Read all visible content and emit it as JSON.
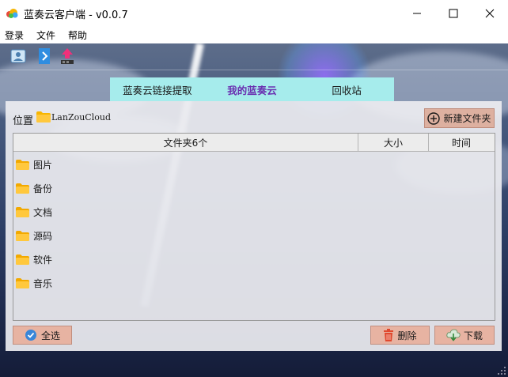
{
  "window": {
    "title": "蓝奏云客户端 - v0.0.7",
    "icon": "cloud-app-icon"
  },
  "menu": [
    "登录",
    "文件",
    "帮助"
  ],
  "toolbar": {
    "items": [
      "login-icon",
      "upload-icon",
      "transfer-icon"
    ]
  },
  "tabs": [
    {
      "label": "蓝奏云链接提取",
      "active": false
    },
    {
      "label": "我的蓝奏云",
      "active": true
    },
    {
      "label": "回收站",
      "active": false
    }
  ],
  "location": {
    "label": "位置",
    "path": "LanZouCloud"
  },
  "new_folder_label": "新建文件夹",
  "table": {
    "headers": [
      "文件夹6个",
      "大小",
      "时间"
    ],
    "rows": [
      {
        "name": "图片",
        "size": "",
        "time": ""
      },
      {
        "name": "备份",
        "size": "",
        "time": ""
      },
      {
        "name": "文档",
        "size": "",
        "time": ""
      },
      {
        "name": "源码",
        "size": "",
        "time": ""
      },
      {
        "name": "软件",
        "size": "",
        "time": ""
      },
      {
        "name": "音乐",
        "size": "",
        "time": ""
      }
    ]
  },
  "actions": {
    "select_all": "全选",
    "delete": "删除",
    "download": "下载"
  },
  "colors": {
    "tab_bar": "#a6ecec",
    "active_tab_text": "#6a2fb0",
    "action_button": "#e7b3a2",
    "folder": "#f7b500"
  }
}
